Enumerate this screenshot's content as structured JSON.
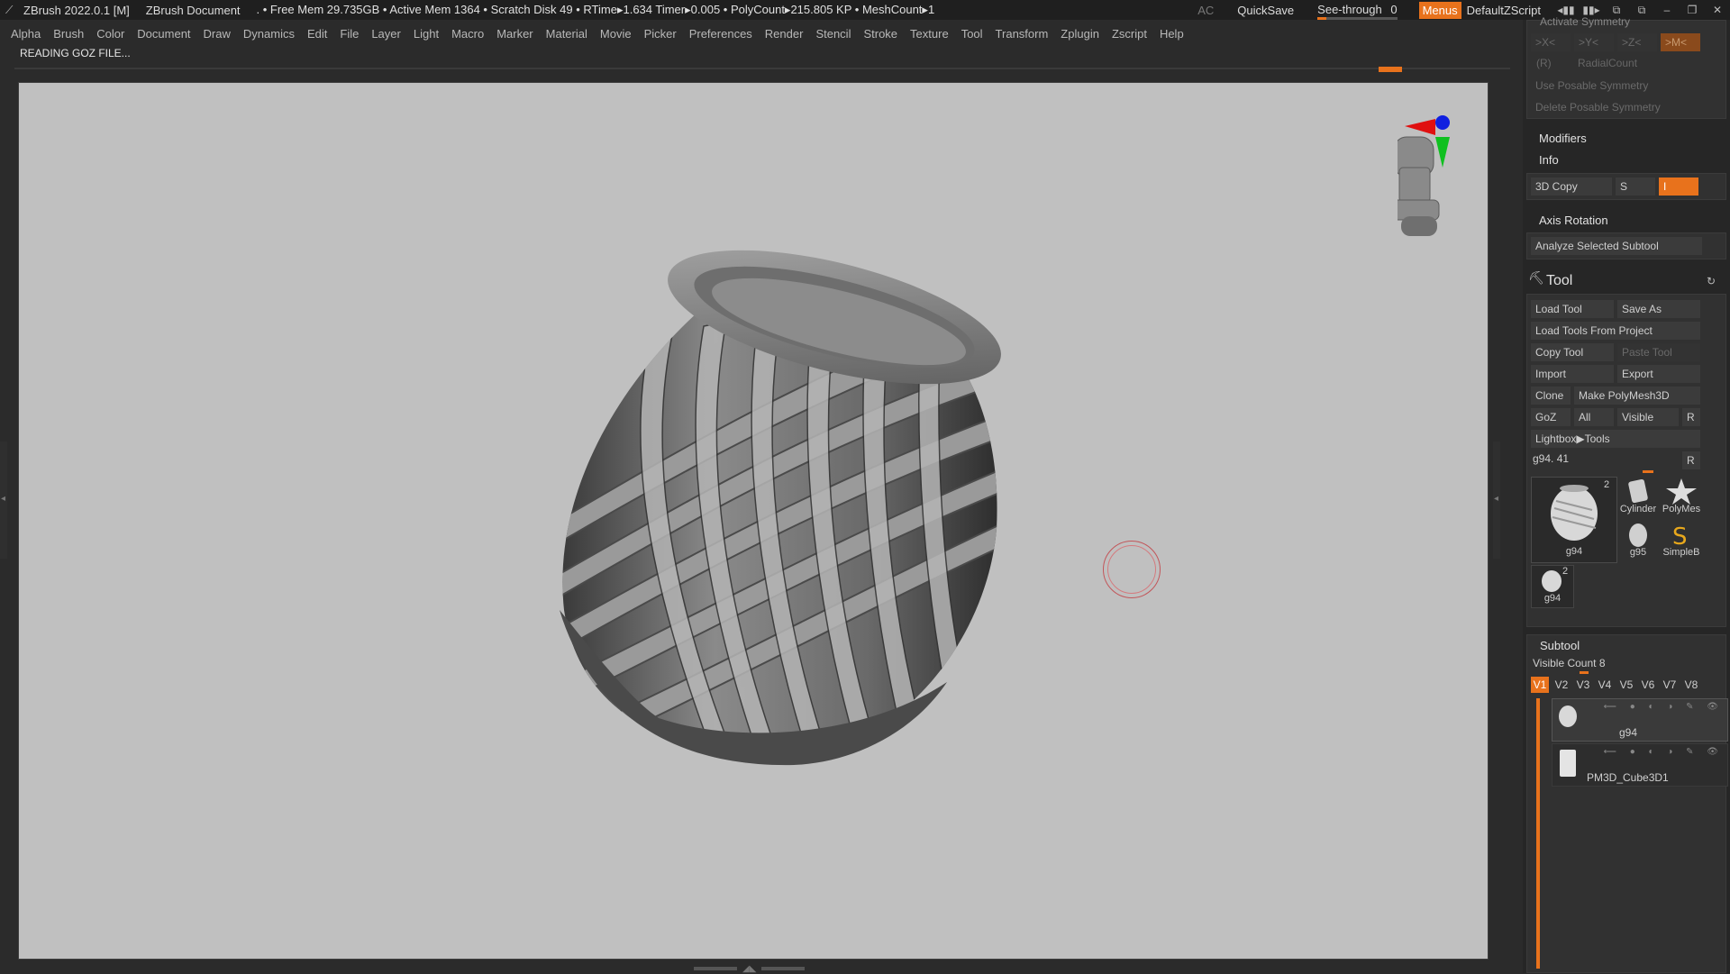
{
  "titlebar": {
    "app": "ZBrush 2022.0.1 [M]",
    "document": "ZBrush Document",
    "stats": ". • Free Mem 29.735GB • Active Mem 1364 • Scratch Disk 49 •  RTime▸1.634 Timer▸0.005 • PolyCount▸215.805 KP  • MeshCount▸1",
    "ac": "AC",
    "quicksave": "QuickSave",
    "see_through_label": "See-through",
    "see_through_value": "0",
    "see_through_level": 0,
    "menus": "Menus",
    "default_script": "DefaultZScript"
  },
  "menubar": [
    "Alpha",
    "Brush",
    "Color",
    "Document",
    "Draw",
    "Dynamics",
    "Edit",
    "File",
    "Layer",
    "Light",
    "Macro",
    "Marker",
    "Material",
    "Movie",
    "Picker",
    "Preferences",
    "Render",
    "Stencil",
    "Stroke",
    "Texture",
    "Tool",
    "Transform",
    "Zplugin",
    "Zscript",
    "Help"
  ],
  "status": "READING GOZ FILE...",
  "panel": {
    "symmetry": {
      "header_partial": "Activate Symmetry",
      "x": ">X<",
      "y": ">Y<",
      "z": ">Z<",
      "m": ">M<",
      "r": "(R)",
      "radial": "RadialCount",
      "use_posable": "Use Posable Symmetry",
      "delete_posable": "Delete Posable Symmetry"
    },
    "modifiers": "Modifiers",
    "info": "Info",
    "copy3d": "3D Copy",
    "copy3d_s": "S",
    "copy3d_i": "I",
    "axis_rotation": "Axis Rotation",
    "analyze": "Analyze Selected Subtool",
    "tool": {
      "title": "Tool",
      "load_tool": "Load Tool",
      "save_as": "Save As",
      "load_from_project": "Load Tools From Project",
      "copy_tool": "Copy Tool",
      "paste_tool": "Paste Tool",
      "import": "Import",
      "export": "Export",
      "clone": "Clone",
      "make_polymesh": "Make PolyMesh3D",
      "goz": "GoZ",
      "all": "All",
      "visible": "Visible",
      "r": "R",
      "lightbox": "Lightbox▶Tools",
      "current": "g94. 41",
      "current_r": "R",
      "thumbs": {
        "main_name": "g94",
        "main_count": "2",
        "cylinder": "Cylinder",
        "polymesh": "PolyMes",
        "g95": "g95",
        "simpleb": "SimpleB",
        "small_name": "g94",
        "small_count": "2"
      }
    },
    "subtool": {
      "title": "Subtool",
      "visible_count": "Visible Count 8",
      "versions": [
        "V1",
        "V2",
        "V3",
        "V4",
        "V5",
        "V6",
        "V7",
        "V8"
      ],
      "items": [
        "g94",
        "PM3D_Cube3D1"
      ]
    }
  }
}
